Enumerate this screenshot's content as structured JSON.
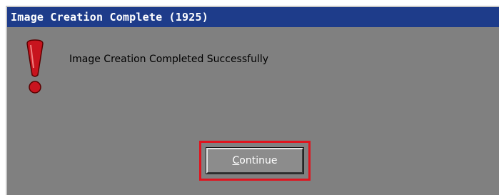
{
  "dialog": {
    "title": "Image Creation Complete (1925)",
    "message": "Image Creation Completed Successfully",
    "icon": "exclamation-icon",
    "button": {
      "label": "Continue",
      "accelerator": "C",
      "label_rest": "ontinue"
    }
  },
  "colors": {
    "titlebar": "#1e3c8a",
    "dialog_background": "#808080",
    "icon_red": "#c8141e",
    "highlight_frame": "#e0141e"
  }
}
